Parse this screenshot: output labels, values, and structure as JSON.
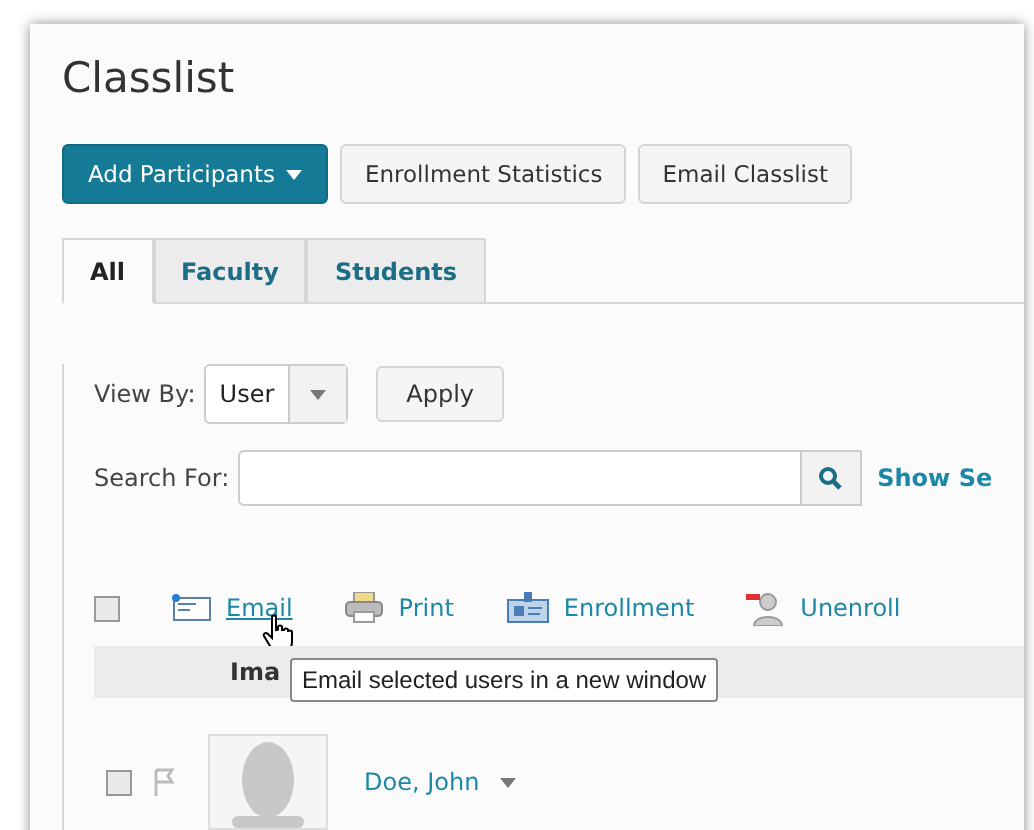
{
  "page": {
    "title": "Classlist"
  },
  "actions": [
    {
      "label": "Add Participants",
      "kind": "primary"
    },
    {
      "label": "Enrollment Statistics",
      "kind": "secondary"
    },
    {
      "label": "Email Classlist",
      "kind": "secondary"
    }
  ],
  "tabs": [
    {
      "label": "All",
      "selected": true
    },
    {
      "label": "Faculty",
      "selected": false
    },
    {
      "label": "Students",
      "selected": false
    }
  ],
  "view_by": {
    "label": "View By:",
    "value": "User",
    "apply": "Apply"
  },
  "search": {
    "label": "Search For:",
    "show_link": "Show Se"
  },
  "toolbar": {
    "select_all": false,
    "items": [
      {
        "label": "Email",
        "kind": "email",
        "hovered": true
      },
      {
        "label": "Print",
        "kind": "print",
        "hovered": false
      },
      {
        "label": "Enrollment",
        "kind": "enrollment",
        "hovered": false
      },
      {
        "label": "Unenroll",
        "kind": "unenroll",
        "hovered": false
      }
    ]
  },
  "table": {
    "columns": [
      "Ima"
    ],
    "rows": [
      {
        "name": "Doe, John",
        "checked": false
      }
    ]
  },
  "tooltip": "Email selected users in a new window"
}
